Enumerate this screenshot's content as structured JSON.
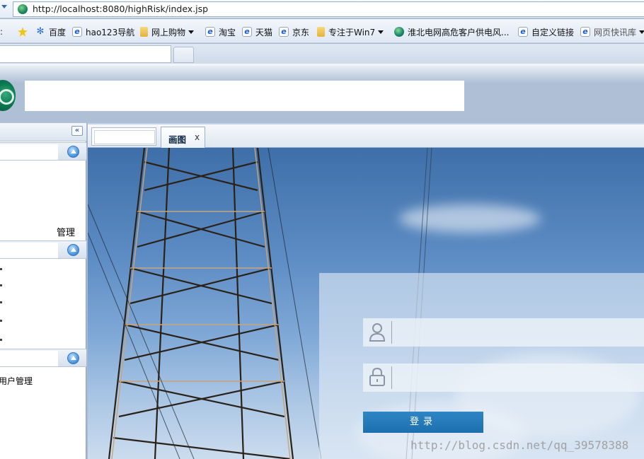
{
  "browser": {
    "url": "http://localhost:8080/highRisk/index.jsp",
    "favorites": [
      {
        "label": "百度",
        "icon": "paw-icon"
      },
      {
        "label": "hao123导航",
        "icon": "ie-page-icon"
      },
      {
        "label": "网上购物",
        "icon": "folder-icon",
        "dropdown": true
      },
      {
        "label": "淘宝",
        "icon": "ie-page-icon"
      },
      {
        "label": "天猫",
        "icon": "ie-page-icon"
      },
      {
        "label": "京东",
        "icon": "ie-page-icon"
      },
      {
        "label": "专注于Win7",
        "icon": "folder-icon",
        "dropdown": true
      },
      {
        "label": "淮北电网高危客户供电风...",
        "icon": "globe-icon"
      },
      {
        "label": "自定义链接",
        "icon": "ie-page-icon"
      },
      {
        "label": "网页快讯库",
        "icon": "ie-page-icon",
        "dropdown": true
      }
    ]
  },
  "left_panel": {
    "text_manage": "管理",
    "text_user_manage": "用户管理"
  },
  "tabs": {
    "active_label": "画图",
    "close": "x"
  },
  "login": {
    "button_label": "登录"
  },
  "watermark": "http://blog.csdn.net/qq_39578388",
  "colors": {
    "login_button": "#1d6fae",
    "panel_border": "#8fa4c0"
  }
}
